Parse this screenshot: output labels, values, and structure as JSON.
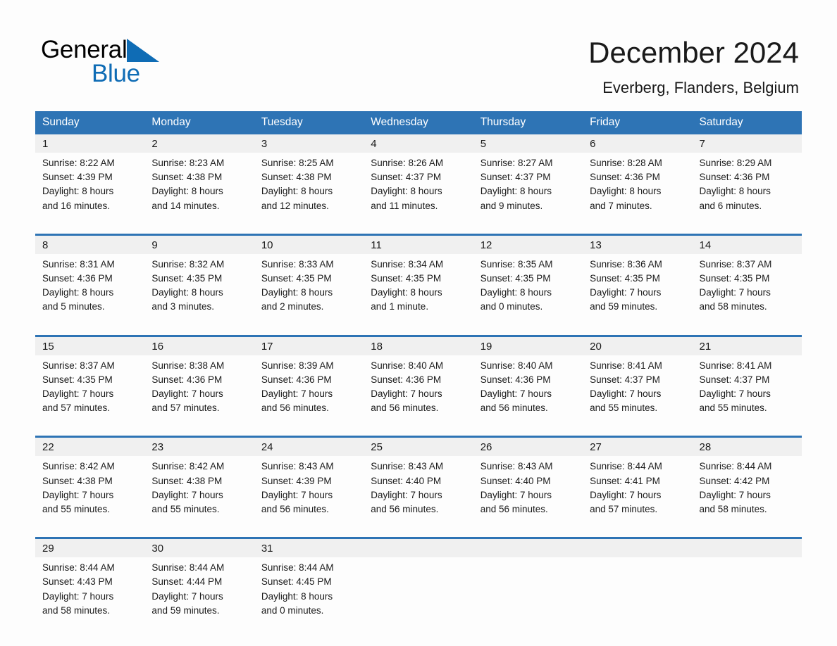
{
  "brand": {
    "name_part1": "General",
    "name_part2": "Blue",
    "triangle_icon": "blue-triangle-icon",
    "accent_blue": "#0f6cb5",
    "header_blue": "#2e74b5"
  },
  "header": {
    "month_title": "December 2024",
    "location": "Everberg, Flanders, Belgium"
  },
  "calendar": {
    "weekday_headers": [
      "Sunday",
      "Monday",
      "Tuesday",
      "Wednesday",
      "Thursday",
      "Friday",
      "Saturday"
    ],
    "weeks": [
      [
        {
          "day": "1",
          "sunrise": "Sunrise: 8:22 AM",
          "sunset": "Sunset: 4:39 PM",
          "daylight_line1": "Daylight: 8 hours",
          "daylight_line2": "and 16 minutes."
        },
        {
          "day": "2",
          "sunrise": "Sunrise: 8:23 AM",
          "sunset": "Sunset: 4:38 PM",
          "daylight_line1": "Daylight: 8 hours",
          "daylight_line2": "and 14 minutes."
        },
        {
          "day": "3",
          "sunrise": "Sunrise: 8:25 AM",
          "sunset": "Sunset: 4:38 PM",
          "daylight_line1": "Daylight: 8 hours",
          "daylight_line2": "and 12 minutes."
        },
        {
          "day": "4",
          "sunrise": "Sunrise: 8:26 AM",
          "sunset": "Sunset: 4:37 PM",
          "daylight_line1": "Daylight: 8 hours",
          "daylight_line2": "and 11 minutes."
        },
        {
          "day": "5",
          "sunrise": "Sunrise: 8:27 AM",
          "sunset": "Sunset: 4:37 PM",
          "daylight_line1": "Daylight: 8 hours",
          "daylight_line2": "and 9 minutes."
        },
        {
          "day": "6",
          "sunrise": "Sunrise: 8:28 AM",
          "sunset": "Sunset: 4:36 PM",
          "daylight_line1": "Daylight: 8 hours",
          "daylight_line2": "and 7 minutes."
        },
        {
          "day": "7",
          "sunrise": "Sunrise: 8:29 AM",
          "sunset": "Sunset: 4:36 PM",
          "daylight_line1": "Daylight: 8 hours",
          "daylight_line2": "and 6 minutes."
        }
      ],
      [
        {
          "day": "8",
          "sunrise": "Sunrise: 8:31 AM",
          "sunset": "Sunset: 4:36 PM",
          "daylight_line1": "Daylight: 8 hours",
          "daylight_line2": "and 5 minutes."
        },
        {
          "day": "9",
          "sunrise": "Sunrise: 8:32 AM",
          "sunset": "Sunset: 4:35 PM",
          "daylight_line1": "Daylight: 8 hours",
          "daylight_line2": "and 3 minutes."
        },
        {
          "day": "10",
          "sunrise": "Sunrise: 8:33 AM",
          "sunset": "Sunset: 4:35 PM",
          "daylight_line1": "Daylight: 8 hours",
          "daylight_line2": "and 2 minutes."
        },
        {
          "day": "11",
          "sunrise": "Sunrise: 8:34 AM",
          "sunset": "Sunset: 4:35 PM",
          "daylight_line1": "Daylight: 8 hours",
          "daylight_line2": "and 1 minute."
        },
        {
          "day": "12",
          "sunrise": "Sunrise: 8:35 AM",
          "sunset": "Sunset: 4:35 PM",
          "daylight_line1": "Daylight: 8 hours",
          "daylight_line2": "and 0 minutes."
        },
        {
          "day": "13",
          "sunrise": "Sunrise: 8:36 AM",
          "sunset": "Sunset: 4:35 PM",
          "daylight_line1": "Daylight: 7 hours",
          "daylight_line2": "and 59 minutes."
        },
        {
          "day": "14",
          "sunrise": "Sunrise: 8:37 AM",
          "sunset": "Sunset: 4:35 PM",
          "daylight_line1": "Daylight: 7 hours",
          "daylight_line2": "and 58 minutes."
        }
      ],
      [
        {
          "day": "15",
          "sunrise": "Sunrise: 8:37 AM",
          "sunset": "Sunset: 4:35 PM",
          "daylight_line1": "Daylight: 7 hours",
          "daylight_line2": "and 57 minutes."
        },
        {
          "day": "16",
          "sunrise": "Sunrise: 8:38 AM",
          "sunset": "Sunset: 4:36 PM",
          "daylight_line1": "Daylight: 7 hours",
          "daylight_line2": "and 57 minutes."
        },
        {
          "day": "17",
          "sunrise": "Sunrise: 8:39 AM",
          "sunset": "Sunset: 4:36 PM",
          "daylight_line1": "Daylight: 7 hours",
          "daylight_line2": "and 56 minutes."
        },
        {
          "day": "18",
          "sunrise": "Sunrise: 8:40 AM",
          "sunset": "Sunset: 4:36 PM",
          "daylight_line1": "Daylight: 7 hours",
          "daylight_line2": "and 56 minutes."
        },
        {
          "day": "19",
          "sunrise": "Sunrise: 8:40 AM",
          "sunset": "Sunset: 4:36 PM",
          "daylight_line1": "Daylight: 7 hours",
          "daylight_line2": "and 56 minutes."
        },
        {
          "day": "20",
          "sunrise": "Sunrise: 8:41 AM",
          "sunset": "Sunset: 4:37 PM",
          "daylight_line1": "Daylight: 7 hours",
          "daylight_line2": "and 55 minutes."
        },
        {
          "day": "21",
          "sunrise": "Sunrise: 8:41 AM",
          "sunset": "Sunset: 4:37 PM",
          "daylight_line1": "Daylight: 7 hours",
          "daylight_line2": "and 55 minutes."
        }
      ],
      [
        {
          "day": "22",
          "sunrise": "Sunrise: 8:42 AM",
          "sunset": "Sunset: 4:38 PM",
          "daylight_line1": "Daylight: 7 hours",
          "daylight_line2": "and 55 minutes."
        },
        {
          "day": "23",
          "sunrise": "Sunrise: 8:42 AM",
          "sunset": "Sunset: 4:38 PM",
          "daylight_line1": "Daylight: 7 hours",
          "daylight_line2": "and 55 minutes."
        },
        {
          "day": "24",
          "sunrise": "Sunrise: 8:43 AM",
          "sunset": "Sunset: 4:39 PM",
          "daylight_line1": "Daylight: 7 hours",
          "daylight_line2": "and 56 minutes."
        },
        {
          "day": "25",
          "sunrise": "Sunrise: 8:43 AM",
          "sunset": "Sunset: 4:40 PM",
          "daylight_line1": "Daylight: 7 hours",
          "daylight_line2": "and 56 minutes."
        },
        {
          "day": "26",
          "sunrise": "Sunrise: 8:43 AM",
          "sunset": "Sunset: 4:40 PM",
          "daylight_line1": "Daylight: 7 hours",
          "daylight_line2": "and 56 minutes."
        },
        {
          "day": "27",
          "sunrise": "Sunrise: 8:44 AM",
          "sunset": "Sunset: 4:41 PM",
          "daylight_line1": "Daylight: 7 hours",
          "daylight_line2": "and 57 minutes."
        },
        {
          "day": "28",
          "sunrise": "Sunrise: 8:44 AM",
          "sunset": "Sunset: 4:42 PM",
          "daylight_line1": "Daylight: 7 hours",
          "daylight_line2": "and 58 minutes."
        }
      ],
      [
        {
          "day": "29",
          "sunrise": "Sunrise: 8:44 AM",
          "sunset": "Sunset: 4:43 PM",
          "daylight_line1": "Daylight: 7 hours",
          "daylight_line2": "and 58 minutes."
        },
        {
          "day": "30",
          "sunrise": "Sunrise: 8:44 AM",
          "sunset": "Sunset: 4:44 PM",
          "daylight_line1": "Daylight: 7 hours",
          "daylight_line2": "and 59 minutes."
        },
        {
          "day": "31",
          "sunrise": "Sunrise: 8:44 AM",
          "sunset": "Sunset: 4:45 PM",
          "daylight_line1": "Daylight: 8 hours",
          "daylight_line2": "and 0 minutes."
        },
        {
          "day": "",
          "sunrise": "",
          "sunset": "",
          "daylight_line1": "",
          "daylight_line2": ""
        },
        {
          "day": "",
          "sunrise": "",
          "sunset": "",
          "daylight_line1": "",
          "daylight_line2": ""
        },
        {
          "day": "",
          "sunrise": "",
          "sunset": "",
          "daylight_line1": "",
          "daylight_line2": ""
        },
        {
          "day": "",
          "sunrise": "",
          "sunset": "",
          "daylight_line1": "",
          "daylight_line2": ""
        }
      ]
    ]
  }
}
